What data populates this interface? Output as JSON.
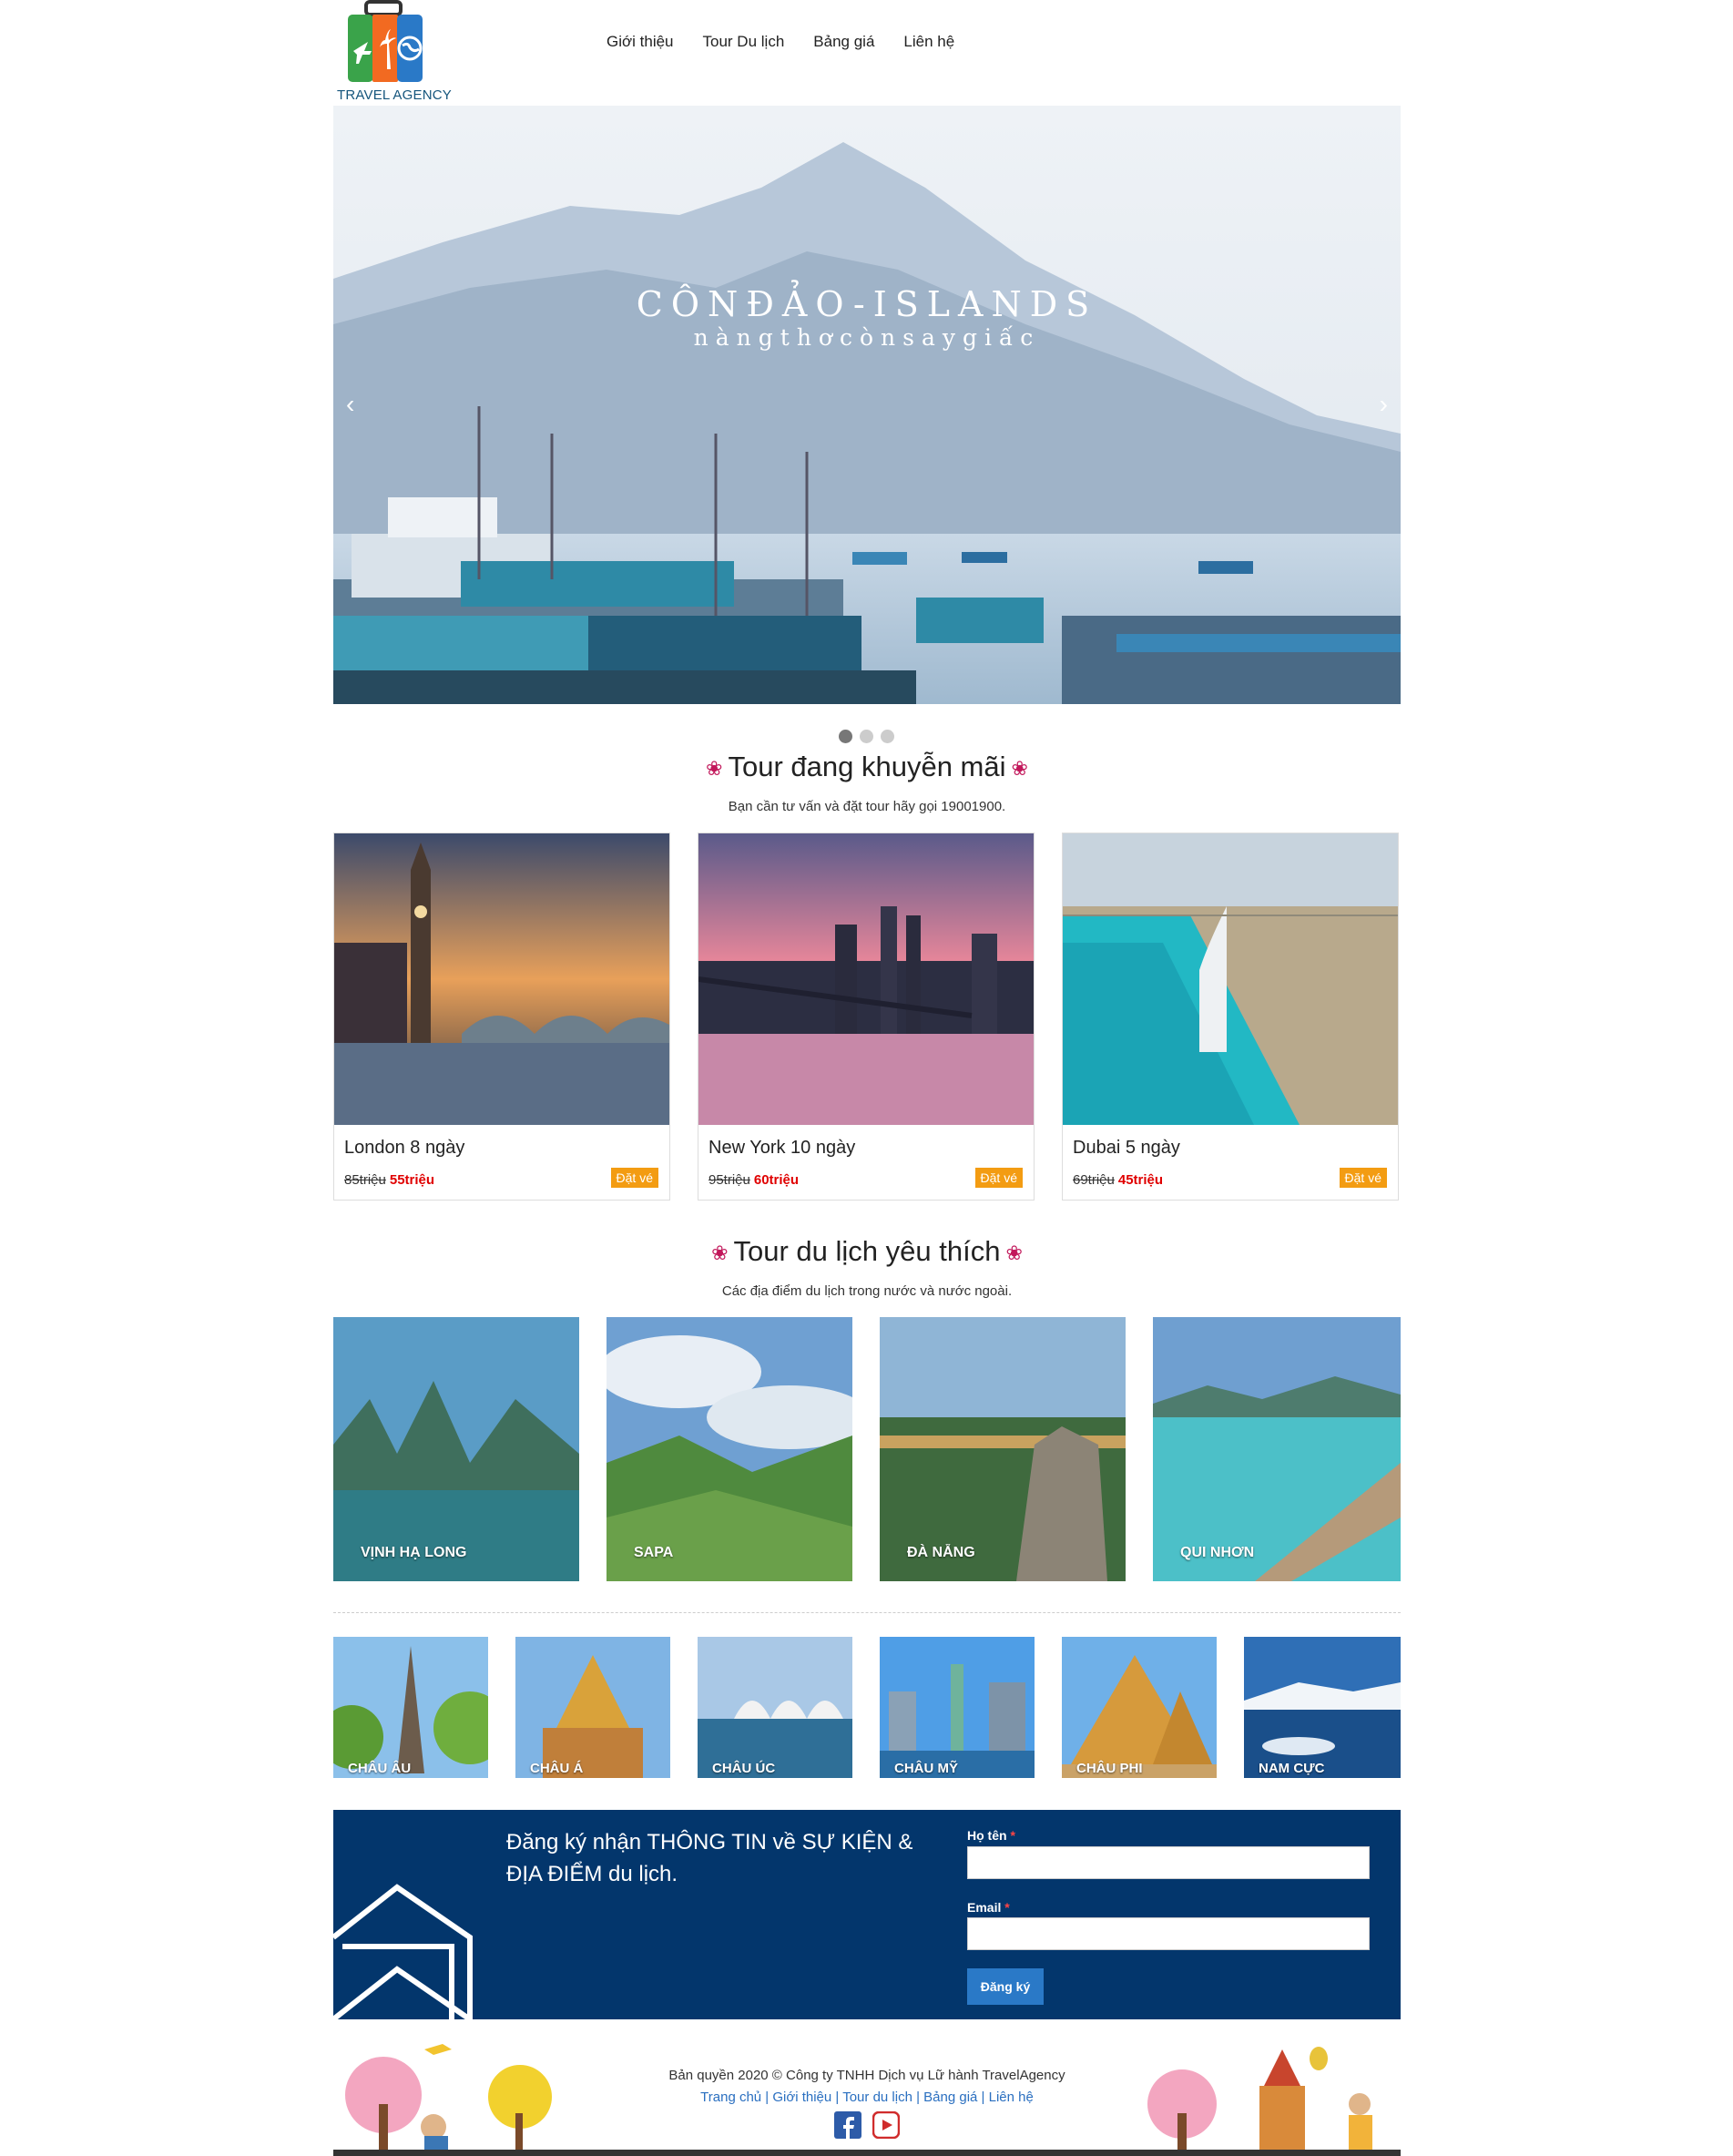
{
  "brand": {
    "name": "TRAVEL AGENCY"
  },
  "nav": [
    "Giới thiệu",
    "Tour Du lịch",
    "Bảng giá",
    "Liên hệ"
  ],
  "hero": {
    "title": "CÔNĐẢO-ISLANDS",
    "subtitle": "nàngthơcònsaygiấc",
    "prev": "‹",
    "next": "›",
    "slides": 3,
    "active_slide": 1
  },
  "promo": {
    "title": "Tour đang khuyễn mãi",
    "subtitle": "Bạn cần tư vấn và đặt tour hãy gọi 19001900.",
    "tours": [
      {
        "name": "London 8 ngày",
        "old_price": "85triệu",
        "new_price": "55triệu",
        "book": "Đặt vé"
      },
      {
        "name": "New York 10 ngày",
        "old_price": "95triệu",
        "new_price": "60triệu",
        "book": "Đặt vé"
      },
      {
        "name": "Dubai 5 ngày",
        "old_price": "69triệu",
        "new_price": "45triệu",
        "book": "Đặt vé"
      }
    ]
  },
  "favorites": {
    "title": "Tour du lịch yêu thích",
    "subtitle": "Các địa điểm du lịch trong nước và nước ngoài.",
    "domestic": [
      "VỊNH HẠ LONG",
      "SAPA",
      "ĐÀ NẴNG",
      "QUI NHƠN"
    ],
    "continents": [
      "CHÂU ÂU",
      "CHÂU Á",
      "CHÂU ÚC",
      "CHÂU MỸ",
      "CHÂU PHI",
      "NAM CỰC"
    ]
  },
  "newsletter": {
    "text": "Đăng ký nhận THÔNG TIN về SỰ KIỆN & ĐỊA ĐIỂM du lịch.",
    "name_label": "Họ tên",
    "email_label": "Email",
    "required_mark": "*",
    "submit": "Đăng ký"
  },
  "footer": {
    "copyright": "Bản quyền 2020 © Công ty TNHH Dịch vụ Lữ hành TravelAgency",
    "links": [
      "Trang chủ",
      "Giới thiệu",
      "Tour du lịch",
      "Bảng giá",
      "Liên hệ"
    ],
    "separator": " | "
  },
  "colors": {
    "newsletter_bg": "#03366c",
    "book_button": "#f39c12",
    "sale_price": "#e00000",
    "link": "#2a6fc0"
  }
}
